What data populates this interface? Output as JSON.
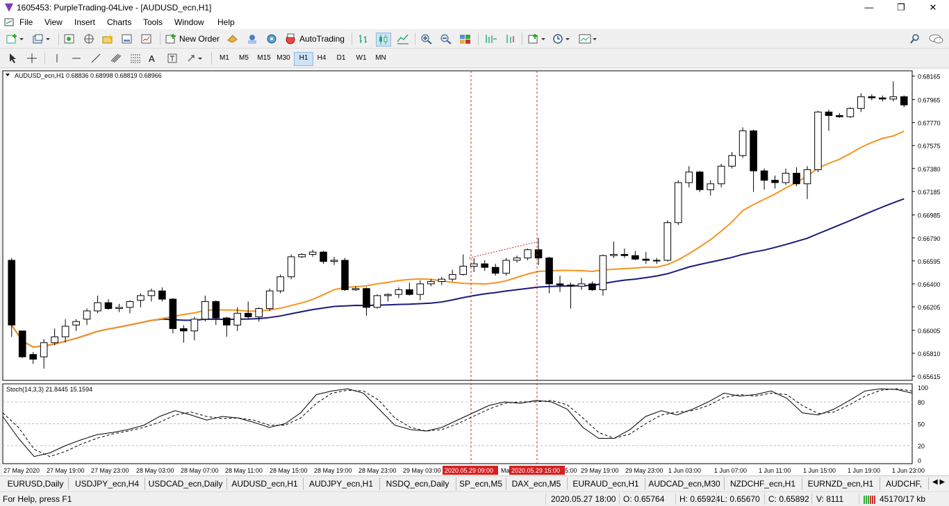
{
  "window": {
    "title": "1605453: PurpleTrading-04Live - [AUDUSD_ecn,H1]",
    "minimize": "—",
    "maximize": "❐",
    "close": "✕"
  },
  "menu": [
    "File",
    "View",
    "Insert",
    "Charts",
    "Tools",
    "Window",
    "Help"
  ],
  "toolbar": {
    "new_order_label": "New Order",
    "autotrading_label": "AutoTrading"
  },
  "timeframes": [
    "M1",
    "M5",
    "M15",
    "M30",
    "H1",
    "H4",
    "D1",
    "W1",
    "MN"
  ],
  "active_timeframe": "H1",
  "chart": {
    "header": "AUDUSD_ecn,H1  0.68836 0.68998 0.68819 0.68966",
    "price_axis": [
      "0.68165",
      "0.67965",
      "0.67770",
      "0.67575",
      "0.67380",
      "0.67185",
      "0.66985",
      "0.66790",
      "0.66595",
      "0.66400",
      "0.66205",
      "0.66005",
      "0.65810",
      "0.65615"
    ],
    "time_axis": [
      "27 May 2020",
      "27 May 19:00",
      "27 May 23:00",
      "28 May 03:00",
      "28 May 07:00",
      "28 May 11:00",
      "28 May 15:00",
      "28 May 19:00",
      "28 May 23:00",
      "29 May 03:00",
      "",
      "Ma",
      "",
      "5:00",
      "29 May 19:00",
      "29 May 23:00",
      "1 Jun 03:00",
      "1 Jun 07:00",
      "1 Jun 11:00",
      "1 Jun 15:00",
      "1 Jun 19:00",
      "1 Jun 23:00"
    ],
    "time_markers": [
      "2020.05.29 09:00",
      "2020.05.29 15:00"
    ],
    "stoch_header": "Stoch(14,3,3) 21.8445 15.1594",
    "stoch_axis": [
      "100",
      "80",
      "50",
      "20",
      "0"
    ],
    "colors": {
      "ma_fast": "#f7931e",
      "ma_slow": "#1a1a7a",
      "bull": "#ffffff",
      "bear": "#000000",
      "vline": "#d62020",
      "marker_bg": "#d62020"
    }
  },
  "chart_data": {
    "type": "candlestick",
    "series_values": [
      [
        0.666,
        0.6662,
        0.6595,
        0.6605
      ],
      [
        0.66,
        0.66,
        0.6577,
        0.6578
      ],
      [
        0.658,
        0.6582,
        0.6572,
        0.6576
      ],
      [
        0.6578,
        0.6593,
        0.6568,
        0.659
      ],
      [
        0.659,
        0.6602,
        0.6588,
        0.6595
      ],
      [
        0.6595,
        0.661,
        0.659,
        0.6604
      ],
      [
        0.6605,
        0.661,
        0.66,
        0.6608
      ],
      [
        0.661,
        0.6619,
        0.6605,
        0.6617
      ],
      [
        0.6617,
        0.663,
        0.6615,
        0.6624
      ],
      [
        0.6624,
        0.6627,
        0.6618,
        0.6619
      ],
      [
        0.6619,
        0.6623,
        0.6616,
        0.662
      ],
      [
        0.662,
        0.6626,
        0.6615,
        0.6625
      ],
      [
        0.6626,
        0.6632,
        0.662,
        0.663
      ],
      [
        0.663,
        0.6636,
        0.6625,
        0.6634
      ],
      [
        0.6634,
        0.6637,
        0.6625,
        0.6627
      ],
      [
        0.6627,
        0.6628,
        0.6598,
        0.6602
      ],
      [
        0.6602,
        0.6605,
        0.659,
        0.66
      ],
      [
        0.66,
        0.6612,
        0.6592,
        0.661
      ],
      [
        0.661,
        0.663,
        0.6608,
        0.6625
      ],
      [
        0.6625,
        0.6626,
        0.6605,
        0.6611
      ],
      [
        0.6611,
        0.6612,
        0.6595,
        0.6605
      ],
      [
        0.6605,
        0.662,
        0.66,
        0.6615
      ],
      [
        0.6615,
        0.6625,
        0.661,
        0.6612
      ],
      [
        0.6612,
        0.662,
        0.6608,
        0.6619
      ],
      [
        0.6619,
        0.6636,
        0.6617,
        0.6634
      ],
      [
        0.6634,
        0.6648,
        0.6632,
        0.6646
      ],
      [
        0.6646,
        0.6665,
        0.6644,
        0.6663
      ],
      [
        0.6663,
        0.6666,
        0.6662,
        0.6665
      ],
      [
        0.6665,
        0.6669,
        0.6663,
        0.6667
      ],
      [
        0.6667,
        0.6668,
        0.6657,
        0.6659
      ],
      [
        0.6659,
        0.6663,
        0.6656,
        0.666
      ],
      [
        0.666,
        0.6662,
        0.6634,
        0.6635
      ],
      [
        0.6635,
        0.6638,
        0.6634,
        0.6636
      ],
      [
        0.6636,
        0.6637,
        0.6613,
        0.662
      ],
      [
        0.662,
        0.6631,
        0.6619,
        0.663
      ],
      [
        0.663,
        0.6632,
        0.6625,
        0.6631
      ],
      [
        0.6631,
        0.6637,
        0.6628,
        0.6635
      ],
      [
        0.6635,
        0.6641,
        0.663,
        0.6631
      ],
      [
        0.6631,
        0.6643,
        0.6626,
        0.664
      ],
      [
        0.664,
        0.6644,
        0.6638,
        0.6642
      ],
      [
        0.6642,
        0.6646,
        0.6639,
        0.6644
      ],
      [
        0.6644,
        0.6652,
        0.6642,
        0.6648
      ],
      [
        0.6648,
        0.6665,
        0.6647,
        0.6655
      ],
      [
        0.6655,
        0.6662,
        0.665,
        0.6657
      ],
      [
        0.6657,
        0.666,
        0.6651,
        0.6654
      ],
      [
        0.6654,
        0.6657,
        0.6647,
        0.6649
      ],
      [
        0.6649,
        0.6662,
        0.6647,
        0.666
      ],
      [
        0.666,
        0.6664,
        0.6658,
        0.6662
      ],
      [
        0.6662,
        0.667,
        0.666,
        0.6669
      ],
      [
        0.6669,
        0.6679,
        0.6656,
        0.6662
      ],
      [
        0.6662,
        0.6663,
        0.6632,
        0.664
      ],
      [
        0.664,
        0.6647,
        0.6633,
        0.6639
      ],
      [
        0.6639,
        0.6641,
        0.6619,
        0.6638
      ],
      [
        0.6638,
        0.6645,
        0.6635,
        0.664
      ],
      [
        0.664,
        0.6642,
        0.6634,
        0.6635
      ],
      [
        0.6635,
        0.6665,
        0.663,
        0.6664
      ],
      [
        0.6664,
        0.6676,
        0.6662,
        0.6665
      ],
      [
        0.6665,
        0.667,
        0.6662,
        0.6664
      ],
      [
        0.6664,
        0.6668,
        0.666,
        0.6661
      ],
      [
        0.6661,
        0.6667,
        0.6657,
        0.666
      ],
      [
        0.666,
        0.6662,
        0.6657,
        0.666
      ],
      [
        0.666,
        0.6694,
        0.6659,
        0.6692
      ],
      [
        0.6692,
        0.6728,
        0.669,
        0.6726
      ],
      [
        0.6726,
        0.674,
        0.6722,
        0.6735
      ],
      [
        0.6735,
        0.6736,
        0.6718,
        0.672
      ],
      [
        0.672,
        0.6728,
        0.6715,
        0.6725
      ],
      [
        0.6725,
        0.6742,
        0.6722,
        0.674
      ],
      [
        0.674,
        0.6752,
        0.6738,
        0.6749
      ],
      [
        0.6749,
        0.6773,
        0.6747,
        0.677
      ],
      [
        0.677,
        0.6771,
        0.6718,
        0.6736
      ],
      [
        0.6736,
        0.6738,
        0.672,
        0.6728
      ],
      [
        0.6728,
        0.6732,
        0.6721,
        0.6726
      ],
      [
        0.6726,
        0.6738,
        0.6724,
        0.6734
      ],
      [
        0.6734,
        0.6739,
        0.6723,
        0.6725
      ],
      [
        0.6725,
        0.674,
        0.6712,
        0.6737
      ],
      [
        0.6737,
        0.6787,
        0.6735,
        0.6786
      ],
      [
        0.6786,
        0.6788,
        0.677,
        0.6783
      ],
      [
        0.6783,
        0.6785,
        0.6781,
        0.6782
      ],
      [
        0.6782,
        0.679,
        0.6781,
        0.6789
      ],
      [
        0.6789,
        0.6802,
        0.6786,
        0.6799
      ],
      [
        0.6799,
        0.6801,
        0.6796,
        0.6798
      ],
      [
        0.6798,
        0.68,
        0.6795,
        0.6797
      ],
      [
        0.6797,
        0.6812,
        0.6795,
        0.6799
      ],
      [
        0.6799,
        0.68,
        0.679,
        0.6792
      ]
    ],
    "stoch_main": [
      60,
      30,
      5,
      10,
      20,
      28,
      35,
      38,
      42,
      48,
      60,
      68,
      62,
      55,
      60,
      58,
      52,
      45,
      50,
      65,
      90,
      95,
      98,
      92,
      70,
      48,
      42,
      40,
      45,
      55,
      65,
      75,
      80,
      78,
      82,
      80,
      70,
      45,
      30,
      30,
      42,
      60,
      68,
      62,
      70,
      80,
      92,
      88,
      90,
      95,
      85,
      65,
      62,
      70,
      82,
      95,
      98,
      97,
      92
    ],
    "stoch_signal": [
      65,
      45,
      15,
      5,
      12,
      22,
      30,
      36,
      40,
      45,
      52,
      62,
      66,
      60,
      57,
      58,
      55,
      48,
      48,
      58,
      78,
      92,
      96,
      95,
      82,
      58,
      45,
      40,
      42,
      50,
      60,
      70,
      78,
      80,
      80,
      82,
      76,
      58,
      38,
      30,
      36,
      50,
      62,
      66,
      68,
      75,
      86,
      90,
      88,
      92,
      90,
      75,
      64,
      66,
      76,
      88,
      96,
      98,
      95
    ]
  },
  "tabs": [
    "EURUSD,Daily",
    "USDJPY_ecn,H4",
    "USDCAD_ecn,Daily",
    "AUDUSD_ecn,H1",
    "AUDJPY_ecn,H1",
    "NSDQ_ecn,Daily",
    "SP_ecn,M5",
    "DAX_ecn,M5",
    "EURAUD_ecn,H1",
    "AUDCAD_ecn,M30",
    "NZDCHF_ecn,H1",
    "EURNZD_ecn,H1",
    "AUDCHF,"
  ],
  "status": {
    "help": "For Help, press F1",
    "datetime": "2020.05.27 18:00",
    "open": "O: 0.65764",
    "high": "H: 0.65924",
    "low": "L: 0.65670",
    "close": "C: 0.65892",
    "volume": "V: 8111",
    "traffic": "45170/17 kb"
  }
}
